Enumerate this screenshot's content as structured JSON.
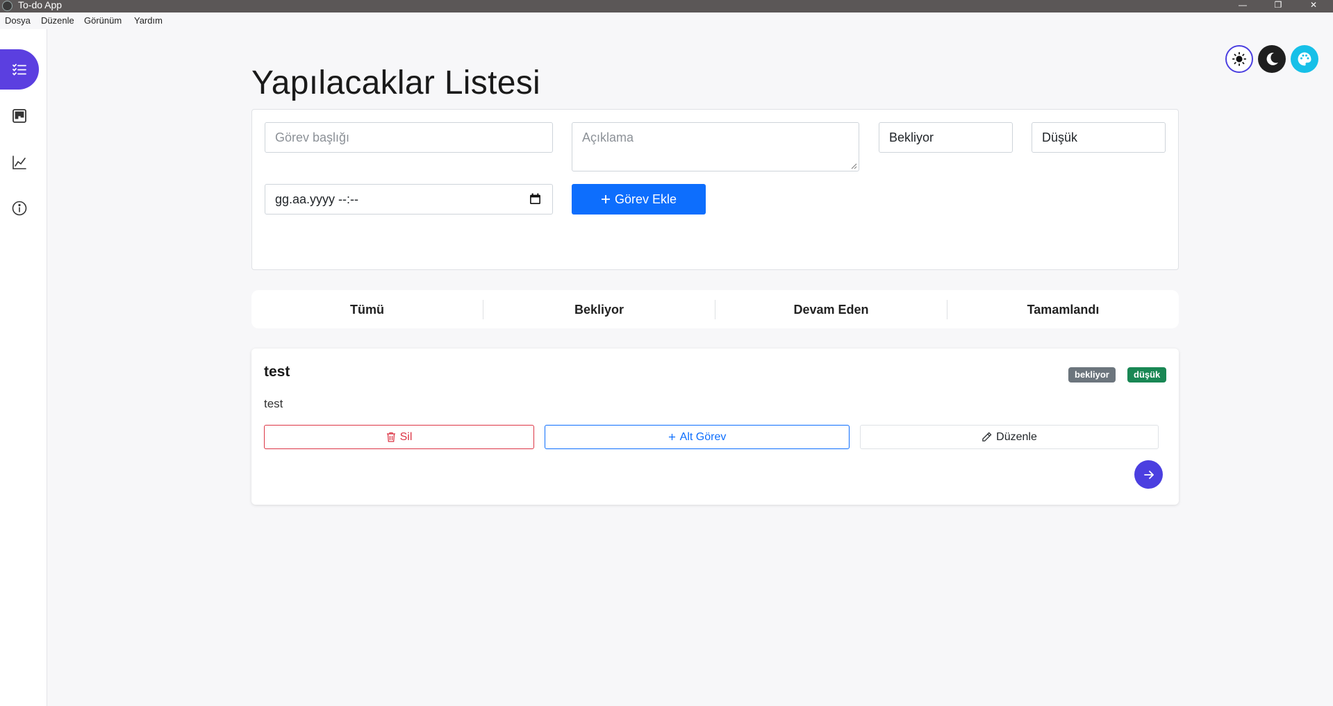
{
  "window": {
    "title": "To-do App",
    "minimize": "—",
    "restore": "❐",
    "close": "✕"
  },
  "menu": {
    "items": [
      "Dosya",
      "Düzenle",
      "Görünüm",
      "Yardım"
    ]
  },
  "sidebar": {
    "items": [
      {
        "icon": "list-icon",
        "active": true
      },
      {
        "icon": "kanban-icon",
        "active": false
      },
      {
        "icon": "chart-line-icon",
        "active": false
      },
      {
        "icon": "info-icon",
        "active": false
      }
    ]
  },
  "theme": {
    "buttons": [
      "sun-icon",
      "moon-icon",
      "palette-icon"
    ],
    "accent_colors": [
      "#4b3fe0",
      "#1f1f1f",
      "#17c0e8"
    ]
  },
  "page": {
    "title": "Yapılacaklar Listesi"
  },
  "form": {
    "title_placeholder": "Görev başlığı",
    "description_placeholder": "Açıklama",
    "status_value": "Bekliyor",
    "priority_value": "Düşük",
    "date_value": "gg.aa.yyyy --:--",
    "add_label": "Görev Ekle"
  },
  "tabs": [
    "Tümü",
    "Bekliyor",
    "Devam Eden",
    "Tamamlandı"
  ],
  "task": {
    "title": "test",
    "description": "test",
    "status_badge": "bekliyor",
    "priority_badge": "düşük",
    "delete_label": "Sil",
    "subtask_label": "Alt Görev",
    "edit_label": "Düzenle"
  },
  "colors": {
    "primary": "#0d6efd",
    "danger": "#dc3545",
    "success": "#198754",
    "secondary": "#6c757d",
    "accent": "#4b3fe0"
  }
}
